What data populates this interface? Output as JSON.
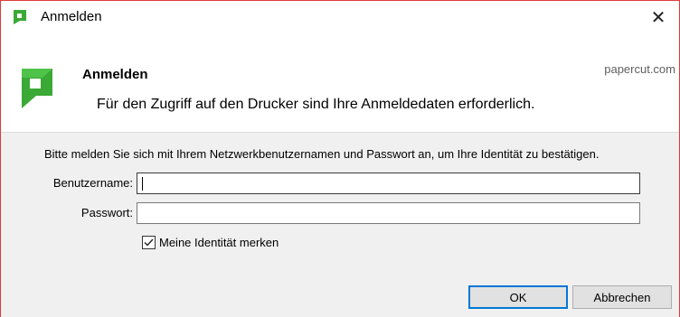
{
  "window": {
    "title": "Anmelden",
    "close_glyph": "✕",
    "accent_color": "#e03a3a"
  },
  "header": {
    "title": "Anmelden",
    "brand": "papercut.com",
    "subtitle": "Für den Zugriff auf den Drucker sind Ihre Anmeldedaten erforderlich.",
    "logo_icon": "papercut-logo-icon",
    "logo_color": "#3aa935"
  },
  "form": {
    "instructions": "Bitte melden Sie sich mit Ihrem Netzwerkbenutzernamen und Passwort an, um Ihre Identität zu bestätigen.",
    "username_label": "Benutzername:",
    "username_value": "",
    "password_label": "Passwort:",
    "password_value": "",
    "remember_label": "Meine Identität merken",
    "remember_checked": true
  },
  "buttons": {
    "ok_label": "OK",
    "cancel_label": "Abbrechen",
    "focus_color": "#0078d7"
  }
}
